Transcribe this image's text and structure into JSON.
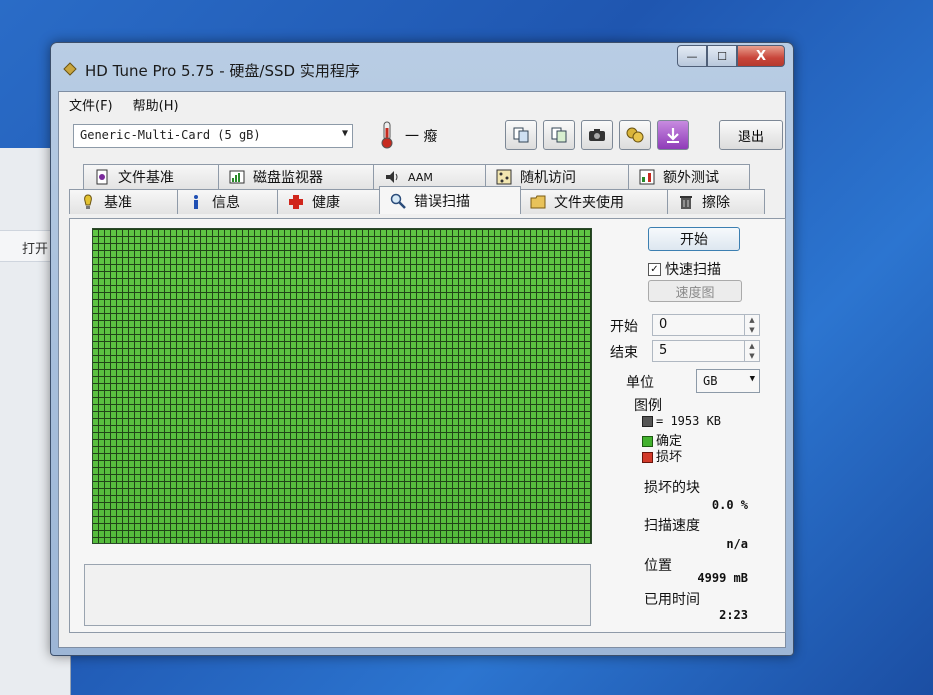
{
  "background_window": {
    "toolbar_text": "打开"
  },
  "window": {
    "title": "HD Tune Pro 5.75 - 硬盘/SSD 实用程序",
    "controls": {
      "minimize": "—",
      "maximize": "☐",
      "close": "X"
    }
  },
  "menu": [
    "文件(F)",
    "帮助(H)"
  ],
  "toolbar": {
    "drive": "Generic-Multi-Card (5 gB)",
    "temperature": "一 癈",
    "exit_label": "退出"
  },
  "tabs_top": [
    {
      "label": "文件基准",
      "icon": "file-benchmark-icon"
    },
    {
      "label": "磁盘监视器",
      "icon": "disk-monitor-icon"
    },
    {
      "label": "AAM",
      "icon": "speaker-icon"
    },
    {
      "label": "随机访问",
      "icon": "random-access-icon"
    },
    {
      "label": "额外测试",
      "icon": "extra-tests-icon"
    }
  ],
  "tabs_bottom": [
    {
      "label": "基准",
      "icon": "benchmark-icon"
    },
    {
      "label": "信息",
      "icon": "info-icon"
    },
    {
      "label": "健康",
      "icon": "health-icon"
    },
    {
      "label": "错误扫描",
      "icon": "magnifier-icon",
      "active": true
    },
    {
      "label": "文件夹使用",
      "icon": "folder-icon"
    },
    {
      "label": "擦除",
      "icon": "trash-icon"
    }
  ],
  "controls": {
    "start_label": "开始",
    "quick_scan_label": "快速扫描",
    "quick_scan_checked": true,
    "speed_map_label": "速度图",
    "start_field_label": "开始",
    "start_value": "0",
    "end_field_label": "结束",
    "end_value": "5",
    "unit_label": "单位",
    "unit_value": "GB"
  },
  "legend": {
    "title": "图例",
    "block_size": "= 1953 KB",
    "ok_label": "确定",
    "bad_label": "损坏",
    "colors": {
      "block": "#555555",
      "ok": "#43b12e",
      "bad": "#d23a2a"
    }
  },
  "stats": {
    "bad_blocks_label": "损坏的块",
    "bad_blocks_value": "0.0 %",
    "scan_speed_label": "扫描速度",
    "scan_speed_value": "n/a",
    "position_label": "位置",
    "position_value": "4999 mB",
    "elapsed_label": "已用时间",
    "elapsed_value": "2:23"
  }
}
